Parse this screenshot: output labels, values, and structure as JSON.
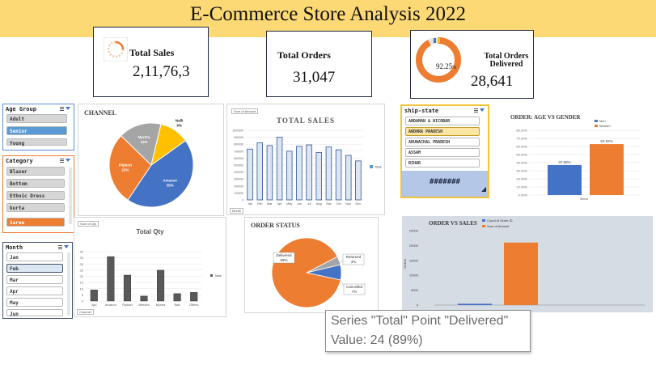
{
  "header": {
    "title": "E-Commerce Store Analysis 2022"
  },
  "kpis": {
    "total_sales": {
      "label": "Total Sales",
      "value": "2,11,76,3"
    },
    "total_orders": {
      "label": "Total Orders",
      "value": "31,047"
    },
    "orders_delivered": {
      "label_line1": "Total Orders",
      "label_line2": "Delivered",
      "value": "28,641",
      "percent": "92.25",
      "percent_unit": "%",
      "ring_fraction": 0.9225
    }
  },
  "slicers": {
    "age_group": {
      "header": "Age Group",
      "items": [
        "Adult",
        "Senior",
        "Young"
      ],
      "selected": "Senior"
    },
    "category": {
      "header": "Category",
      "items": [
        "Blazer",
        "Bottom",
        "Ethnic Dress",
        "kurta",
        "Saree"
      ],
      "selected": "Saree"
    },
    "month": {
      "header": "Month",
      "items": [
        "Jan",
        "Feb",
        "Mar",
        "Apr",
        "May",
        "Jun"
      ],
      "selected": "Feb"
    },
    "ship_state": {
      "header": "ship-state",
      "items": [
        "ANDAMAN & NICOBAR",
        "ANDHRA PRADESH",
        "ARUNACHAL PRADESH",
        "ASSAM",
        "BIHAR"
      ],
      "selected": "ANDHRA PRADESH",
      "more_label": "#######"
    }
  },
  "charts_meta": {
    "channel": {
      "title": "CHANNEL"
    },
    "total_sales": {
      "title": "TOTAL SALES",
      "tag": "Sum of Amount",
      "legend": "Total",
      "filter": "Month"
    },
    "age_gender": {
      "title": "ORDER: AGE VS GENDER",
      "legend_men": "Men",
      "legend_women": "Women",
      "bar1_label": "37.08%",
      "bar2_label": "62.92%",
      "x_label": "Senior"
    },
    "total_qty": {
      "title": "Total Qty",
      "tag": "Sum of Qty",
      "legend": "Total",
      "filter": "Channel"
    },
    "order_status": {
      "title": "ORDER STATUS"
    },
    "order_vs_sales": {
      "title": "ORDER VS SALES",
      "legend_1": "Count of Order ID",
      "legend_2": "Sum of Amount",
      "y_label": "Orders"
    }
  },
  "chart_data": [
    {
      "type": "pie",
      "title": "CHANNEL",
      "slices": [
        {
          "name": "Amazon",
          "value": 35,
          "label": "35%",
          "color": "#4472c4"
        },
        {
          "name": "Flipkart",
          "value": 22,
          "label": "22%",
          "color": "#ed7d31"
        },
        {
          "name": "Myntra",
          "value": 13,
          "label": "13%",
          "color": "#a5a5a5"
        },
        {
          "name": "Nalli",
          "value": 9,
          "label": "9%",
          "color": "#ffc000"
        }
      ]
    },
    {
      "type": "bar",
      "title": "TOTAL SALES",
      "categories": [
        "Jan",
        "Feb",
        "Mar",
        "Apr",
        "May",
        "Jun",
        "Jul",
        "Aug",
        "Sep",
        "Oct",
        "Nov",
        "Dec"
      ],
      "series": [
        {
          "name": "Total",
          "values": [
            730000,
            820000,
            780000,
            900000,
            700000,
            770000,
            790000,
            680000,
            760000,
            720000,
            640000,
            560000
          ]
        }
      ],
      "ylim": [
        0,
        1000000
      ],
      "y_ticks": [
        "0",
        "100000",
        "200000",
        "300000",
        "400000",
        "500000",
        "600000",
        "700000",
        "800000",
        "900000",
        "1000000"
      ]
    },
    {
      "type": "bar",
      "title": "ORDER: AGE VS GENDER",
      "categories": [
        "Senior"
      ],
      "series": [
        {
          "name": "Men",
          "values": [
            37.08
          ]
        },
        {
          "name": "Women",
          "values": [
            62.92
          ]
        }
      ],
      "ylim": [
        0,
        80
      ],
      "y_ticks": [
        "0.00%",
        "10.00%",
        "20.00%",
        "30.00%",
        "40.00%",
        "50.00%",
        "60.00%",
        "70.00%",
        "80.00%"
      ]
    },
    {
      "type": "bar",
      "title": "Total Qty",
      "categories": [
        "Ajio",
        "Amazon",
        "Flipkart",
        "Meesho",
        "Myntra",
        "Nalli",
        "Others"
      ],
      "series": [
        {
          "name": "Total",
          "values": [
            9,
            36,
            21,
            4,
            25,
            6,
            7
          ]
        }
      ],
      "ylim": [
        0,
        40
      ],
      "y_ticks": [
        "0",
        "5",
        "10",
        "15",
        "20",
        "25",
        "30",
        "35",
        "40"
      ]
    },
    {
      "type": "pie",
      "title": "ORDER STATUS",
      "slices": [
        {
          "name": "Delivered",
          "value": 89,
          "label": "Delivered\n89%",
          "color": "#ed7d31"
        },
        {
          "name": "Returned",
          "value": 4,
          "label": "Returned\n4%",
          "color": "#a5a5a5"
        },
        {
          "name": "Cancelled",
          "value": 7,
          "label": "Cancelled\n7%",
          "color": "#4472c4"
        }
      ]
    },
    {
      "type": "bar",
      "title": "ORDER VS SALES",
      "categories": [
        ""
      ],
      "series": [
        {
          "name": "Count of Order ID",
          "values": [
            450
          ]
        },
        {
          "name": "Sum of Amount",
          "values": [
            21000
          ]
        }
      ],
      "ylim": [
        0,
        25000
      ],
      "y_ticks": [
        "0",
        "5000",
        "10000",
        "15000",
        "20000",
        "25000"
      ]
    }
  ],
  "tooltip": {
    "line1": "Series \"Total\" Point \"Delivered\"",
    "line2": "Value: 24 (89%)"
  }
}
